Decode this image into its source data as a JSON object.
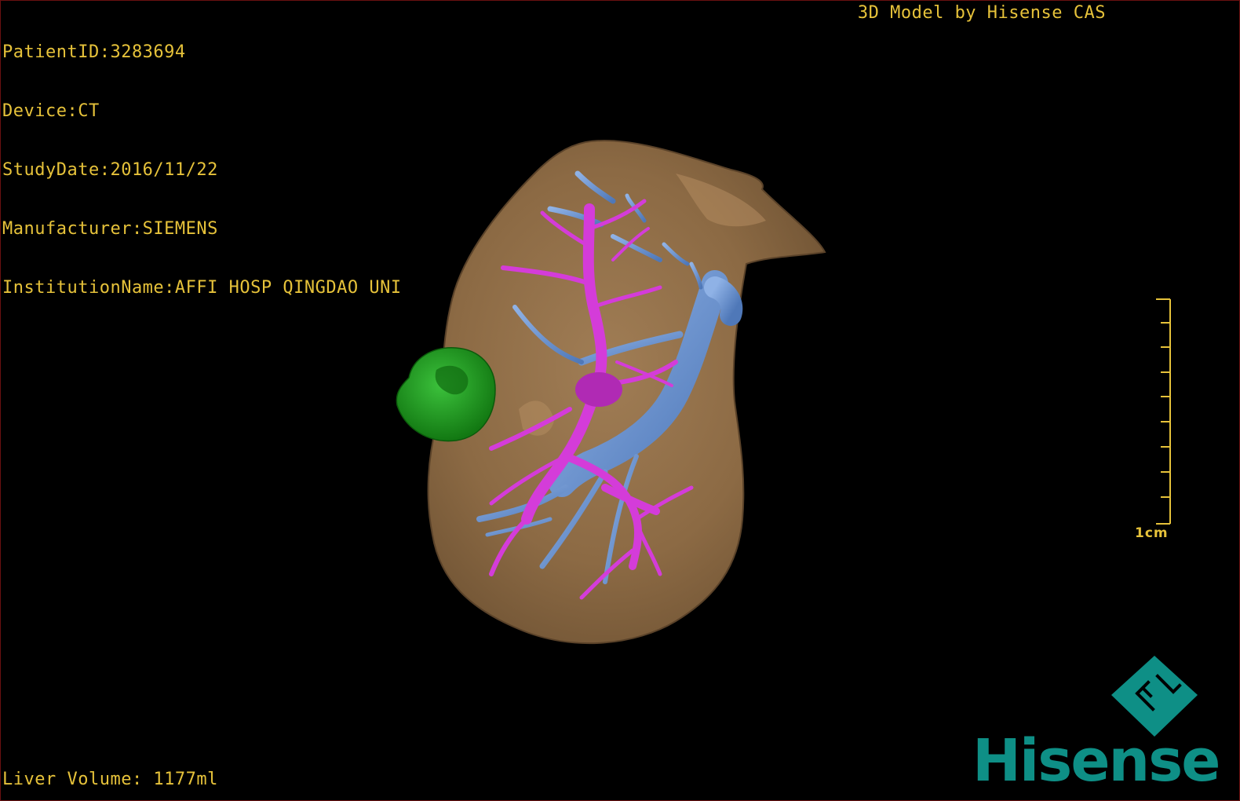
{
  "study_info": {
    "patient_id": "PatientID:3283694",
    "device": "Device:CT",
    "study_date": "StudyDate:2016/11/22",
    "manufacturer": "Manufacturer:SIEMENS",
    "institution": "InstitutionName:AFFI HOSP QINGDAO UNI"
  },
  "brand_caption": "3D Model by Hisense CAS",
  "liver_volume": "Liver Volume: 1177ml",
  "scale": {
    "label": "1cm",
    "tick_count": 10
  },
  "logo": {
    "mark_text": "FL",
    "word": "Hisense"
  },
  "colors": {
    "text": "#e6c23a",
    "liver": "#8c6a44",
    "portal_vein": "#d43cd9",
    "hepatic_vein": "#6e98d6",
    "lesion": "#1ea01e",
    "brand": "#0e8f86"
  },
  "icons": {
    "logo_mark": "diamond-logo-icon"
  }
}
